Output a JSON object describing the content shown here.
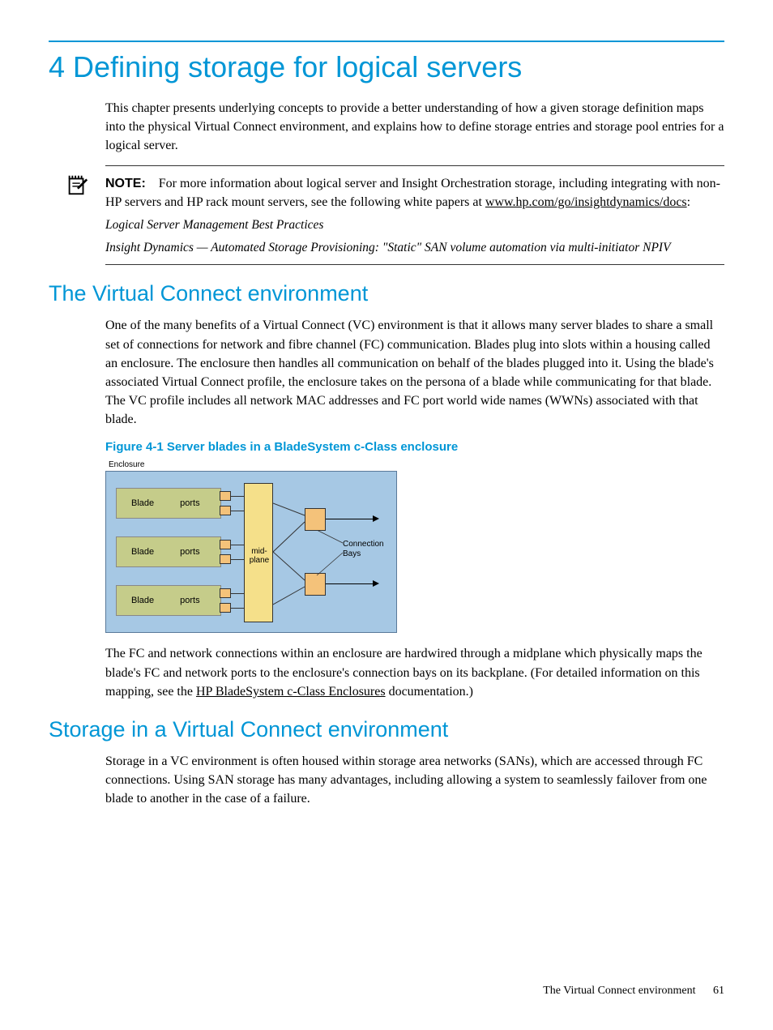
{
  "chapter": {
    "number": "4",
    "title": "Defining storage for logical servers",
    "intro": "This chapter presents underlying concepts to provide a better understanding of how a given storage definition maps into the physical Virtual Connect environment, and explains how to define storage entries and storage pool entries for a logical server."
  },
  "note": {
    "label": "NOTE:",
    "text_before_link": "For more information about logical server and Insight Orchestration storage, including integrating with non-HP servers and HP rack mount servers, see the following white papers at ",
    "link": "www.hp.com/go/insightdynamics/docs",
    "text_after_link": ":",
    "refs": [
      "Logical Server Management Best Practices",
      "Insight Dynamics — Automated Storage Provisioning: \"Static\" SAN volume automation via multi-initiator NPIV"
    ]
  },
  "section1": {
    "title": "The Virtual Connect environment",
    "para1": "One of the many benefits of a Virtual Connect (VC) environment is that it allows many server blades to share a small set of connections for network and fibre channel (FC) communication. Blades plug into slots within a housing called an enclosure. The enclosure then handles all communication on behalf of the blades plugged into it. Using the blade's associated Virtual Connect profile, the enclosure takes on the persona of a blade while communicating for that blade. The VC profile includes all network MAC addresses and FC port world wide names (WWNs) associated with that blade.",
    "figure_caption": "Figure 4-1 Server blades in a BladeSystem c-Class enclosure",
    "para2_before_link": "The FC and network connections within an enclosure are hardwired through a midplane which physically maps the blade's FC and network ports to the enclosure's connection bays on its backplane. (For detailed information on this mapping, see the ",
    "para2_link": "HP BladeSystem c-Class Enclosures",
    "para2_after_link": " documentation.)"
  },
  "diagram": {
    "enclosure_label": "Enclosure",
    "blade_label": "Blade",
    "ports_label": "ports",
    "midplane_label": "mid-plane",
    "connection_bays_label": "Connection Bays"
  },
  "section2": {
    "title": "Storage in a Virtual Connect environment",
    "para1": "Storage in a VC environment is often housed within storage area networks (SANs), which are accessed through FC connections. Using SAN storage has many advantages, including allowing a system to seamlessly failover from one blade to another in the case of a failure."
  },
  "footer": {
    "section": "The Virtual Connect environment",
    "page": "61"
  }
}
